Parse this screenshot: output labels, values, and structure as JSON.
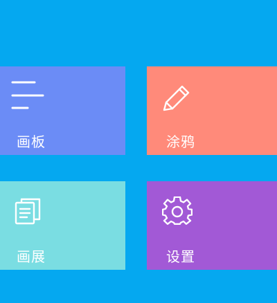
{
  "colors": {
    "background": "#05A8F0",
    "board": "#6B8CF6",
    "doodle": "#FF8A7A",
    "gallery": "#7ADDE2",
    "settings": "#A259D6"
  },
  "tiles": [
    {
      "label": "画板",
      "icon": "menu-lines-icon"
    },
    {
      "label": "涂鸦",
      "icon": "pencil-icon"
    },
    {
      "label": "画展",
      "icon": "document-icon"
    },
    {
      "label": "设置",
      "icon": "gear-icon"
    }
  ]
}
